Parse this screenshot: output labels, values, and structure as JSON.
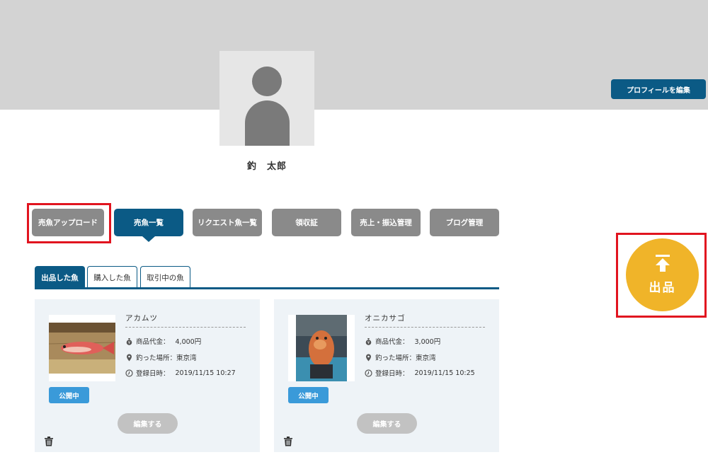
{
  "header": {
    "user_name": "釣　太郎",
    "edit_profile_label": "プロフィールを編集"
  },
  "menu": {
    "items": [
      {
        "label": "売魚アップロード",
        "active": false,
        "highlighted": true
      },
      {
        "label": "売魚一覧",
        "active": true,
        "highlighted": false
      },
      {
        "label": "リクエスト魚一覧",
        "active": false,
        "highlighted": false
      },
      {
        "label": "領収証",
        "active": false,
        "highlighted": false
      },
      {
        "label": "売上・振込管理",
        "active": false,
        "highlighted": false
      },
      {
        "label": "ブログ管理",
        "active": false,
        "highlighted": false
      }
    ]
  },
  "tabs": [
    {
      "label": "出品した魚",
      "active": true
    },
    {
      "label": "購入した魚",
      "active": false
    },
    {
      "label": "取引中の魚",
      "active": false
    }
  ],
  "cards": [
    {
      "name": "アカムツ",
      "price_label": "商品代金：",
      "price": "4,000円",
      "location_label": "釣った場所：",
      "location": "東京湾",
      "date_label": "登録日時：",
      "date": "2019/11/15 10:27",
      "status": "公開中",
      "edit_label": "編集する"
    },
    {
      "name": "オニカサゴ",
      "price_label": "商品代金：",
      "price": "3,000円",
      "location_label": "釣った場所：",
      "location": "東京湾",
      "date_label": "登録日時：",
      "date": "2019/11/15 10:25",
      "status": "公開中",
      "edit_label": "編集する"
    }
  ],
  "upload_button": {
    "label": "出品"
  },
  "colors": {
    "primary": "#0b5a85",
    "menu_gray": "#8a8a8a",
    "badge_blue": "#3a9ad9",
    "upload_yellow": "#f0b429",
    "highlight_red": "#e1141f",
    "card_bg": "#eef3f7"
  },
  "icons": {
    "price": "money-bag-icon",
    "location": "map-pin-icon",
    "date": "clock-icon",
    "delete": "trash-icon",
    "upload": "arrow-up-to-line-icon"
  }
}
